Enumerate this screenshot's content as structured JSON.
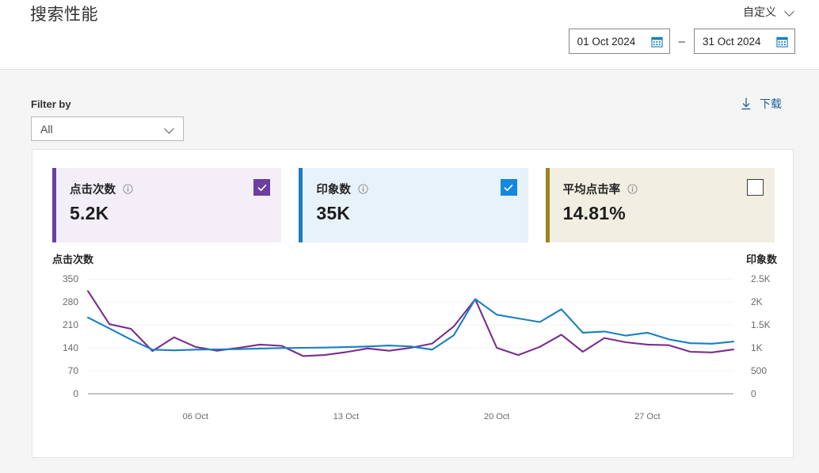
{
  "header": {
    "title": "搜索性能",
    "preset_label": "自定义",
    "chevron_icon": "chevron-down-icon",
    "date_start": "01 Oct 2024",
    "date_end": "31 Oct 2024",
    "date_separator": "–",
    "calendar_icon": "calendar-icon"
  },
  "filter": {
    "label": "Filter by",
    "selected": "All",
    "chevron_icon": "chevron-down-icon",
    "download_label": "下载",
    "download_icon": "download-icon"
  },
  "cards": [
    {
      "title": "点击次数",
      "value": "5.2K",
      "info_icon": "info-icon",
      "checked": true,
      "accent": "#6B3FA0",
      "bg": "#F3EEF8",
      "checkbox_fill": "#6B3FA0"
    },
    {
      "title": "印象数",
      "value": "35K",
      "info_icon": "info-icon",
      "checked": true,
      "accent": "#1A7FBF",
      "bg": "#E8F2FA",
      "checkbox_fill": "#1289DE"
    },
    {
      "title": "平均点击率",
      "value": "14.81%",
      "info_icon": "info-icon",
      "checked": false,
      "accent": "#9A8323",
      "bg": "#F2EEE2",
      "checkbox_fill": "#FFFFFF"
    }
  ],
  "chart_data": {
    "type": "line",
    "title": "",
    "left_axis_title": "点击次数",
    "right_axis_title": "印象数",
    "xlabel": "",
    "x_tick_labels": [
      "06 Oct",
      "13 Oct",
      "20 Oct",
      "27 Oct"
    ],
    "x_tick_indices": [
      5,
      12,
      19,
      26
    ],
    "x": [
      "01 Oct",
      "02 Oct",
      "03 Oct",
      "04 Oct",
      "05 Oct",
      "06 Oct",
      "07 Oct",
      "08 Oct",
      "09 Oct",
      "10 Oct",
      "11 Oct",
      "12 Oct",
      "13 Oct",
      "14 Oct",
      "15 Oct",
      "16 Oct",
      "17 Oct",
      "18 Oct",
      "19 Oct",
      "20 Oct",
      "21 Oct",
      "22 Oct",
      "23 Oct",
      "24 Oct",
      "25 Oct",
      "26 Oct",
      "27 Oct",
      "28 Oct",
      "29 Oct",
      "30 Oct",
      "31 Oct"
    ],
    "left_axis": {
      "ticks": [
        0,
        70,
        140,
        210,
        280,
        350
      ],
      "tick_labels": [
        "0",
        "70",
        "140",
        "210",
        "280",
        "350"
      ],
      "ylim": [
        0,
        350
      ]
    },
    "right_axis": {
      "ticks": [
        0,
        500,
        1000,
        1500,
        2000,
        2500
      ],
      "tick_labels": [
        "0",
        "500",
        "1K",
        "1.5K",
        "2K",
        "2.5K"
      ],
      "ylim": [
        0,
        2500
      ]
    },
    "grid": true,
    "legend": "none",
    "series": [
      {
        "name": "点击次数",
        "axis": "left",
        "color": "#7B2D8E",
        "values": [
          313,
          212,
          198,
          130,
          172,
          143,
          131,
          140,
          150,
          146,
          115,
          118,
          127,
          138,
          131,
          140,
          153,
          205,
          288,
          140,
          118,
          143,
          180,
          128,
          170,
          157,
          150,
          148,
          128,
          126,
          135
        ]
      },
      {
        "name": "印象数",
        "axis": "right",
        "color": "#1A7FBF",
        "values": [
          1660,
          1420,
          1180,
          960,
          945,
          960,
          965,
          970,
          985,
          995,
          1000,
          1005,
          1015,
          1030,
          1050,
          1030,
          960,
          1270,
          2060,
          1720,
          1640,
          1560,
          1840,
          1330,
          1355,
          1265,
          1330,
          1185,
          1100,
          1090,
          1135
        ]
      }
    ]
  }
}
